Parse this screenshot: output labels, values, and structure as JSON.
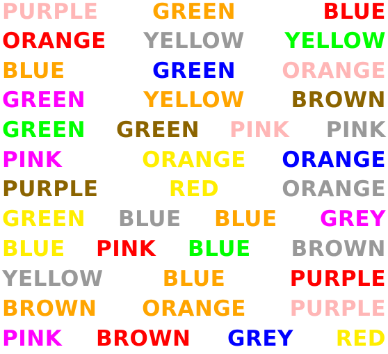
{
  "rows": [
    [
      {
        "text": "PURPLE",
        "color": "#FFB6B6"
      },
      {
        "text": "GREEN",
        "color": "#FFA500"
      },
      {
        "text": "BLUE",
        "color": "#FF0000"
      }
    ],
    [
      {
        "text": "ORANGE",
        "color": "#FF0000"
      },
      {
        "text": "YELLOW",
        "color": "#999999"
      },
      {
        "text": "YELLOW",
        "color": "#00FF00"
      }
    ],
    [
      {
        "text": "BLUE",
        "color": "#FFA500"
      },
      {
        "text": "GREEN",
        "color": "#0000FF"
      },
      {
        "text": "ORANGE",
        "color": "#FFB6B6"
      }
    ],
    [
      {
        "text": "GREEN",
        "color": "#FF00FF"
      },
      {
        "text": "YELLOW",
        "color": "#FFA500"
      },
      {
        "text": "BROWN",
        "color": "#8B6400"
      }
    ],
    [
      {
        "text": "GREEN",
        "color": "#00FF00"
      },
      {
        "text": "GREEN",
        "color": "#8B6400"
      },
      {
        "text": "PINK",
        "color": "#FFB6B6"
      },
      {
        "text": "PINK",
        "color": "#999999"
      }
    ],
    [
      {
        "text": "PINK",
        "color": "#FF00FF"
      },
      {
        "text": "ORANGE",
        "color": "#FFEE00"
      },
      {
        "text": "ORANGE",
        "color": "#0000FF"
      }
    ],
    [
      {
        "text": "PURPLE",
        "color": "#8B6400"
      },
      {
        "text": "RED",
        "color": "#FFEE00"
      },
      {
        "text": "ORANGE",
        "color": "#999999"
      }
    ],
    [
      {
        "text": "GREEN",
        "color": "#FFEE00"
      },
      {
        "text": "BLUE",
        "color": "#999999"
      },
      {
        "text": "BLUE",
        "color": "#FFA500"
      },
      {
        "text": "GREY",
        "color": "#FF00FF"
      }
    ],
    [
      {
        "text": "BLUE",
        "color": "#FFEE00"
      },
      {
        "text": "PINK",
        "color": "#FF0000"
      },
      {
        "text": "BLUE",
        "color": "#00FF00"
      },
      {
        "text": "BROWN",
        "color": "#999999"
      }
    ],
    [
      {
        "text": "YELLOW",
        "color": "#999999"
      },
      {
        "text": "BLUE",
        "color": "#FFA500"
      },
      {
        "text": "PURPLE",
        "color": "#FF0000"
      }
    ],
    [
      {
        "text": "BROWN",
        "color": "#FFA500"
      },
      {
        "text": "ORANGE",
        "color": "#FFA500"
      },
      {
        "text": "PURPLE",
        "color": "#FFB6B6"
      }
    ],
    [
      {
        "text": "PINK",
        "color": "#FF00FF"
      },
      {
        "text": "BROWN",
        "color": "#FF0000"
      },
      {
        "text": "GREY",
        "color": "#0000FF"
      },
      {
        "text": "RED",
        "color": "#FFEE00"
      }
    ]
  ]
}
